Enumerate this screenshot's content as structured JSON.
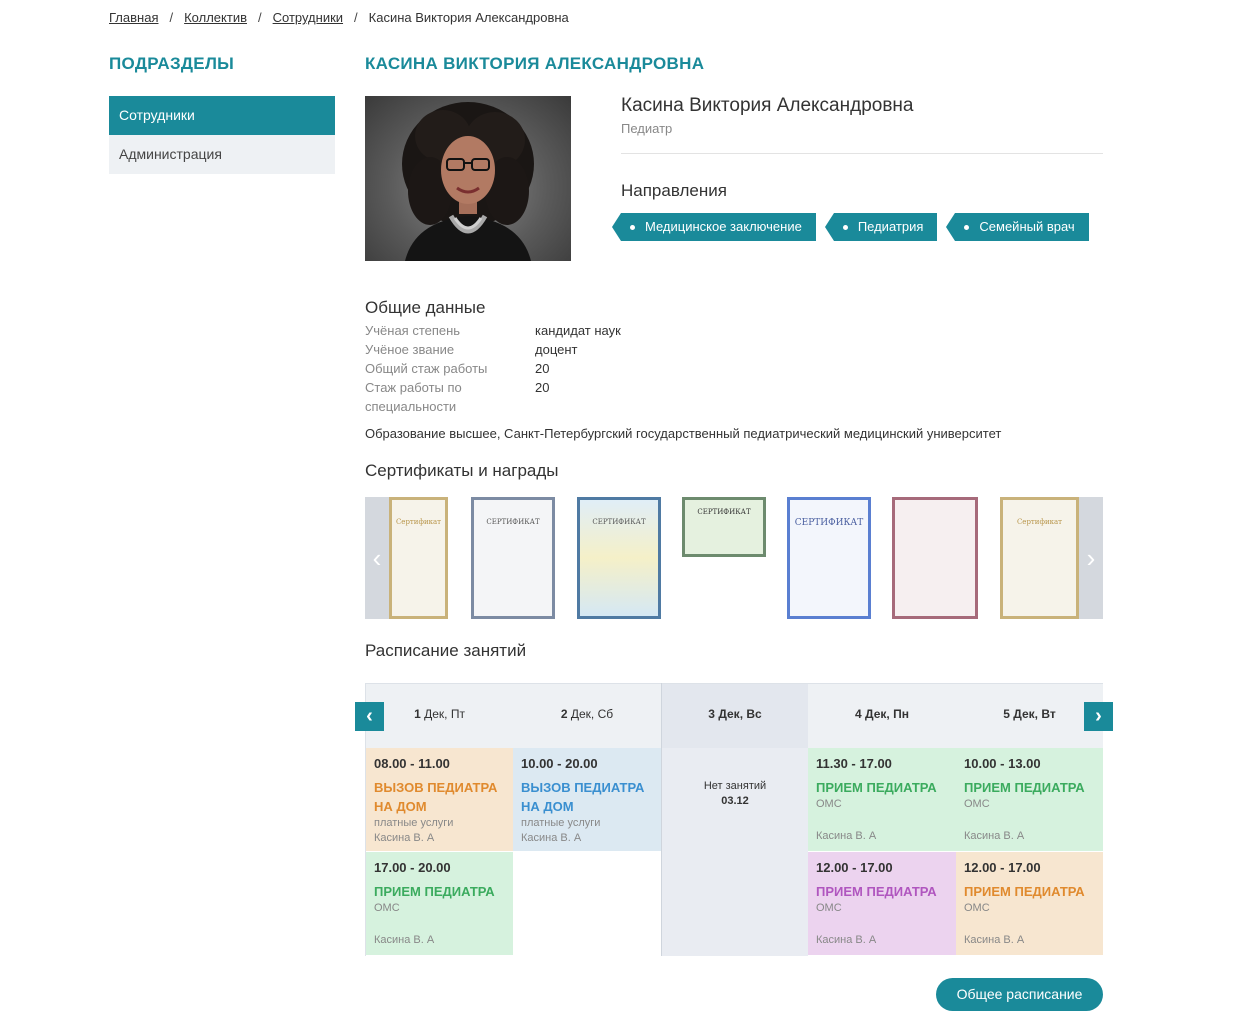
{
  "breadcrumb": {
    "items": [
      "Главная",
      "Коллектив",
      "Сотрудники"
    ],
    "current": "Касина Виктория Александровна",
    "separator": "/"
  },
  "sidebar": {
    "title": "ПОДРАЗДЕЛЫ",
    "items": [
      {
        "label": "Сотрудники",
        "active": true
      },
      {
        "label": "Администрация",
        "active": false
      }
    ]
  },
  "main": {
    "title": "КАСИНА ВИКТОРИЯ АЛЕКСАНДРОВНА"
  },
  "profile": {
    "name": "Касина Виктория Александровна",
    "role": "Педиатр",
    "directions_title": "Направления",
    "directions": [
      "Медицинское заключение",
      "Педиатрия",
      "Семейный врач"
    ]
  },
  "general": {
    "title": "Общие данные",
    "rows": [
      {
        "label": "Учёная степень",
        "value": "кандидат наук"
      },
      {
        "label": "Учёное звание",
        "value": "доцент"
      },
      {
        "label": "Общий стаж работы",
        "value": "20"
      },
      {
        "label": "Стаж работы по специальности",
        "value": "20"
      }
    ],
    "education": "Образование высшее, Санкт-Петербургский государственный педиатрический медицинский университет"
  },
  "certificates": {
    "title": "Сертификаты и награды",
    "items": [
      "Сертификат",
      "СЕРТИФИКАТ",
      "СЕРТИФИКАТ",
      "СЕРТИФИКАТ",
      "СЕРТИФИКАТ",
      "",
      "Сертификат"
    ]
  },
  "schedule": {
    "title": "Расписание занятий",
    "days": [
      {
        "date": "1",
        "rest": "Дек, Пт"
      },
      {
        "date": "2",
        "rest": "Дек, Сб"
      },
      {
        "date": "3",
        "rest": "Дек, Вс"
      },
      {
        "date": "4",
        "rest": "Дек, Пн"
      },
      {
        "date": "5",
        "rest": "Дек, Вт"
      }
    ],
    "events": {
      "d1a": {
        "time": "08.00 - 11.00",
        "type": "ВЫЗОВ ПЕДИАТРА НА ДОМ",
        "sub": "платные услуги",
        "doc": "Касина В. А"
      },
      "d1b": {
        "time": "17.00 - 20.00",
        "type": "ПРИЕМ ПЕДИАТРА",
        "sub": "ОМС",
        "doc": "Касина В. А"
      },
      "d2a": {
        "time": "10.00 - 20.00",
        "type": "ВЫЗОВ ПЕДИАТРА НА ДОМ",
        "sub": "платные услуги",
        "doc": "Касина В. А"
      },
      "d3": {
        "line1": "Нет занятий",
        "line2": "03.12"
      },
      "d4a": {
        "time": "11.30 - 17.00",
        "type": "ПРИЕМ ПЕДИАТРА",
        "sub": "ОМС",
        "doc": "Касина В. А"
      },
      "d4b": {
        "time": "12.00 - 17.00",
        "type": "ПРИЕМ ПЕДИАТРА",
        "sub": "ОМС",
        "doc": "Касина В. А"
      },
      "d5a": {
        "time": "10.00 - 13.00",
        "type": "ПРИЕМ ПЕДИАТРА",
        "sub": "ОМС",
        "doc": "Касина В. А"
      },
      "d5b": {
        "time": "12.00 - 17.00",
        "type": "ПРИЕМ ПЕДИАТРА",
        "sub": "ОМС",
        "doc": "Касина В. А"
      }
    },
    "all_button": "Общее расписание"
  },
  "colors": {
    "accent": "#1a8a9a",
    "orange": "#e08a2e",
    "blue": "#3a8fd0",
    "green": "#3bab5e",
    "purple": "#b056bf"
  }
}
